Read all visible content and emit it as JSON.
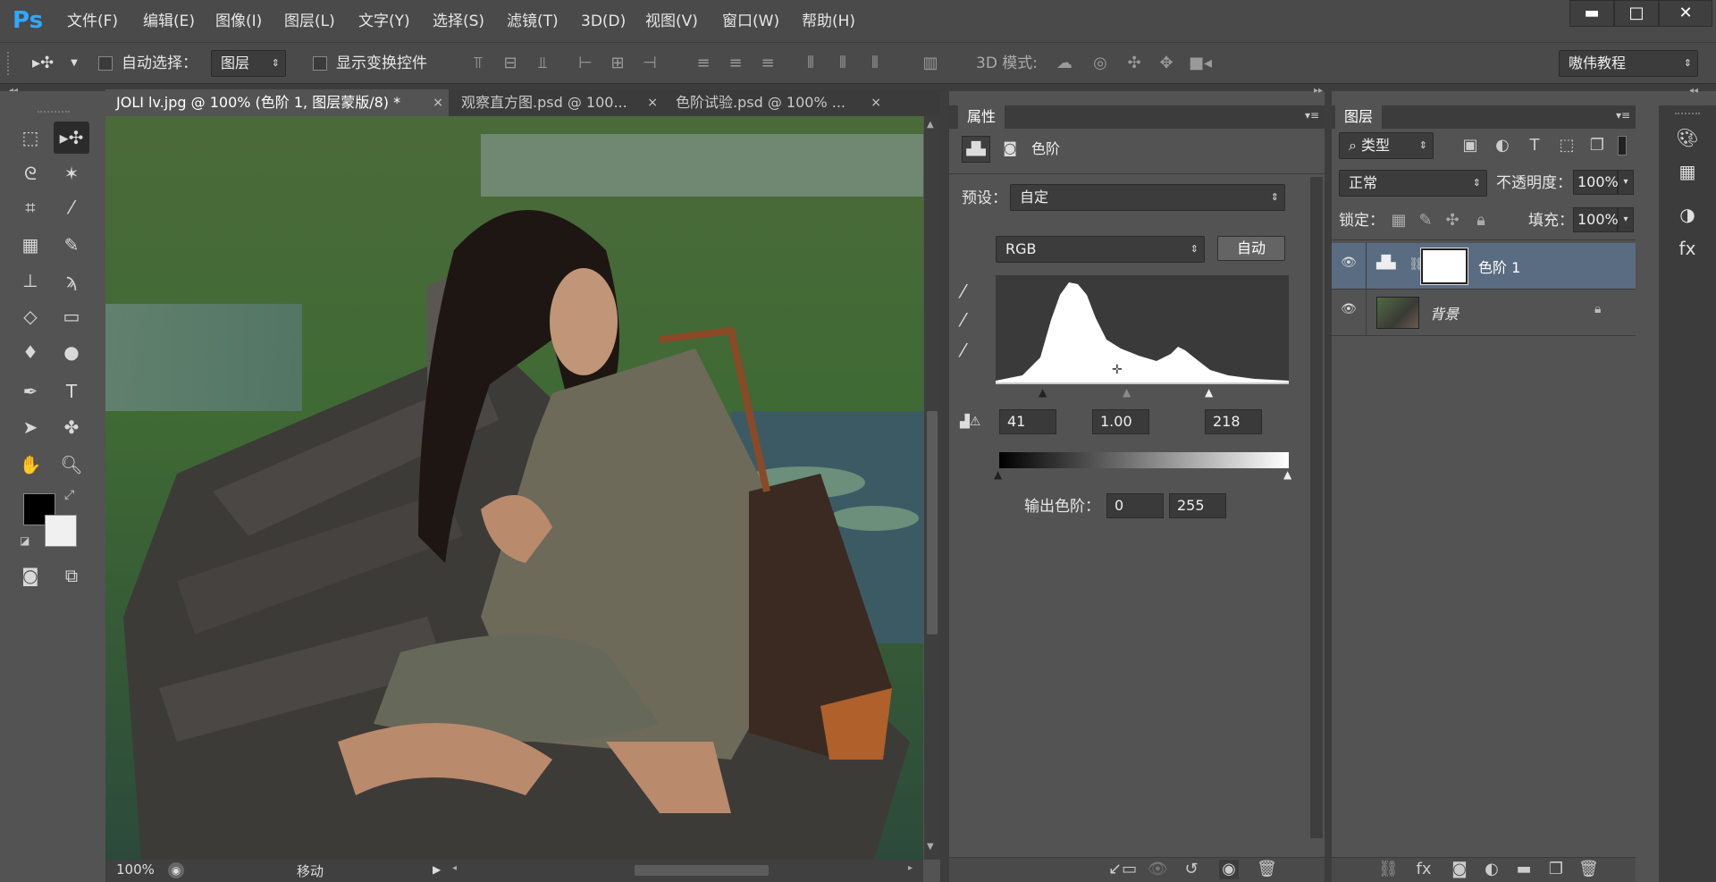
{
  "app": {
    "logo": "Ps"
  },
  "menu": [
    "文件(F)",
    "编辑(E)",
    "图像(I)",
    "图层(L)",
    "文字(Y)",
    "选择(S)",
    "滤镜(T)",
    "3D(D)",
    "视图(V)",
    "窗口(W)",
    "帮助(H)"
  ],
  "window_controls": {
    "minimize": "▬",
    "maximize": "□",
    "close": "✕"
  },
  "options": {
    "auto_select_label": "自动选择：",
    "auto_select_value": "图层",
    "show_transform_label": "显示变换控件",
    "mode_3d_label": "3D 模式:",
    "workspace_value": "嗷伟教程"
  },
  "tabs": [
    {
      "label": "JOLI lv.jpg @ 100% (色阶 1, 图层蒙版/8) *",
      "close": "×"
    },
    {
      "label": "观察直方图.psd @ 100...",
      "close": "×"
    },
    {
      "label": "色阶试验.psd @ 100% ...",
      "close": "×"
    }
  ],
  "status": {
    "zoom": "100%",
    "tool": "移动"
  },
  "properties": {
    "panel_title": "属性",
    "adjustment_name": "色阶",
    "preset_label": "预设：",
    "preset_value": "自定",
    "channel_value": "RGB",
    "auto_button": "自动",
    "input_black": "41",
    "input_gamma": "1.00",
    "input_white": "218",
    "output_label": "输出色阶：",
    "output_black": "0",
    "output_white": "255"
  },
  "layers": {
    "panel_title": "图层",
    "filter_value": "类型",
    "blend_mode": "正常",
    "opacity_label": "不透明度：",
    "opacity_value": "100%",
    "lock_label": "锁定：",
    "fill_label": "填充：",
    "fill_value": "100%",
    "items": [
      {
        "name": "色阶 1",
        "selected": true
      },
      {
        "name": "背景",
        "selected": false
      }
    ]
  },
  "colors": {
    "accent": "#31a8ff",
    "selected_layer": "#5a6c82"
  }
}
